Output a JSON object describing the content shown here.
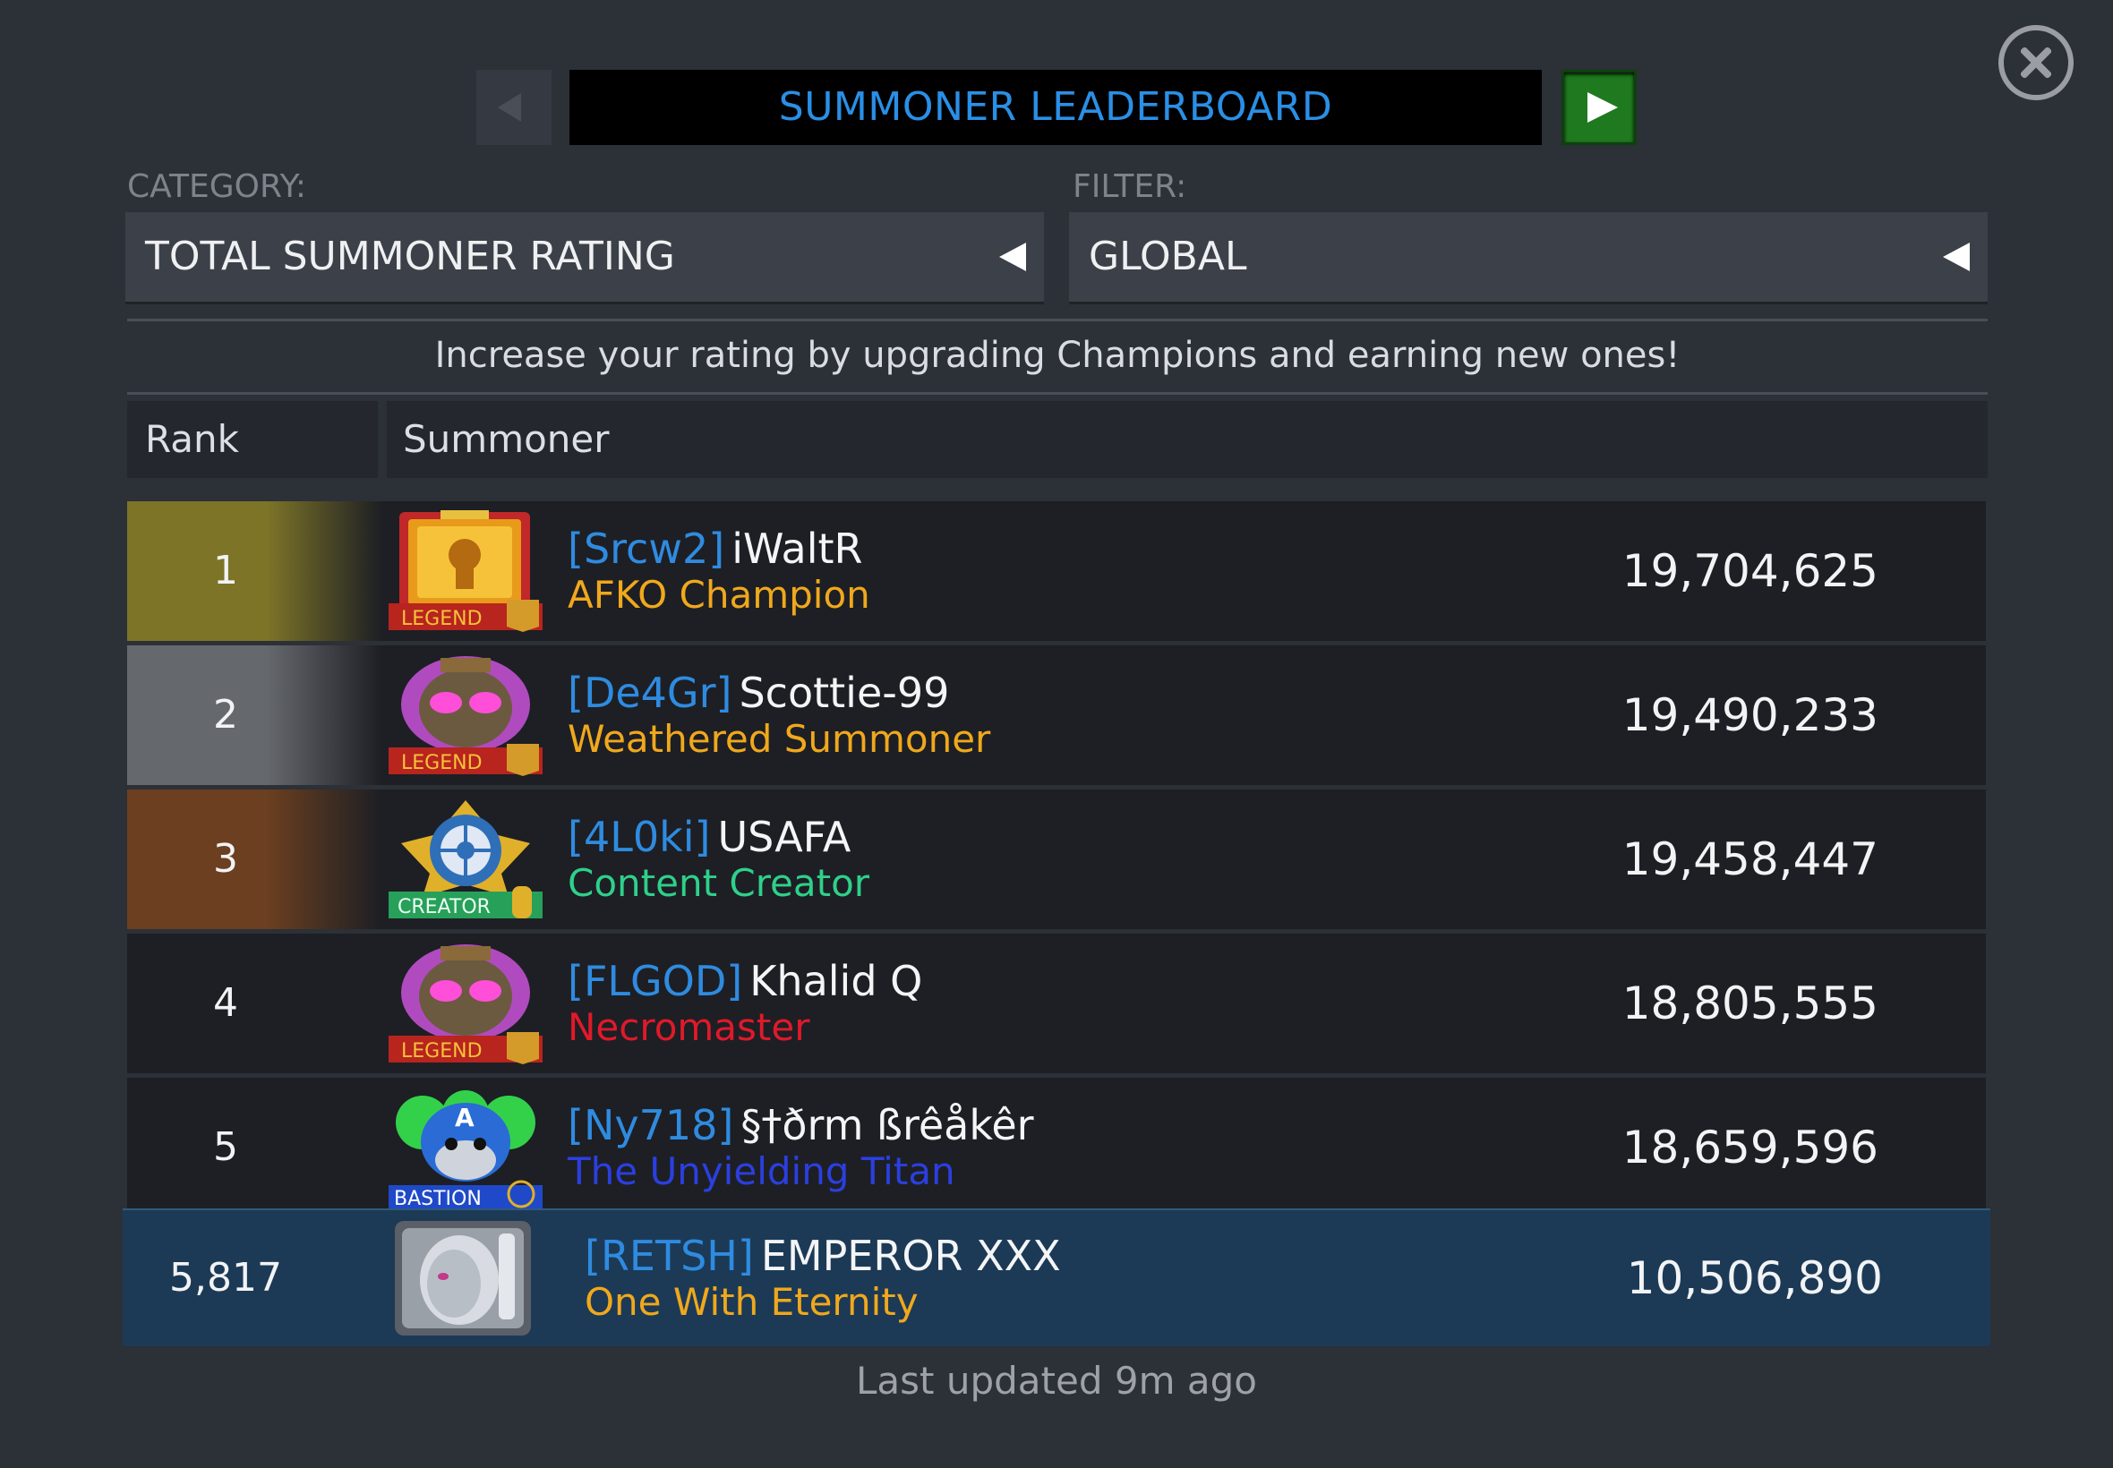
{
  "header": {
    "title": "SUMMONER LEADERBOARD"
  },
  "category": {
    "label": "CATEGORY:",
    "value": "TOTAL SUMMONER RATING"
  },
  "filter": {
    "label": "FILTER:",
    "value": "GLOBAL"
  },
  "hint": "Increase your rating by upgrading Champions and earning new ones!",
  "columns": {
    "rank": "Rank",
    "summoner": "Summoner"
  },
  "rows": [
    {
      "rank": "1",
      "tag": "[Srcw2]",
      "name": "iWaltR",
      "title": "AFKO Champion",
      "title_color": "#f0a81c",
      "score": "19,704,625",
      "badge": "LEGEND",
      "avatar": "gold-keyhole-avatar-icon"
    },
    {
      "rank": "2",
      "tag": "[De4Gr]",
      "name": "Scottie-99",
      "title": "Weathered Summoner",
      "title_color": "#f0a81c",
      "score": "19,490,233",
      "badge": "LEGEND",
      "avatar": "star-lord-helmet-avatar-icon"
    },
    {
      "rank": "3",
      "tag": "[4L0ki]",
      "name": "USAFA",
      "title": "Content Creator",
      "title_color": "#2fd08a",
      "score": "19,458,447",
      "badge": "CREATOR",
      "avatar": "compass-emblem-avatar-icon"
    },
    {
      "rank": "4",
      "tag": "[FLGOD]",
      "name": "Khalid Q",
      "title": "Necromaster",
      "title_color": "#e0192a",
      "score": "18,805,555",
      "badge": "LEGEND",
      "avatar": "star-lord-helmet-avatar-icon"
    },
    {
      "rank": "5",
      "tag": "[Ny718]",
      "name": "§†ðrm ßrêåkêr",
      "title": "The Unyielding Titan",
      "title_color": "#2b3fe0",
      "score": "18,659,596",
      "badge": "BASTION",
      "avatar": "captain-america-zombie-avatar-icon"
    }
  ],
  "me": {
    "rank": "5,817",
    "tag": "[RETSH]",
    "name": "EMPEROR XXX",
    "title": "One With Eternity",
    "title_color": "#f0a81c",
    "score": "10,506,890",
    "avatar": "silver-head-avatar-icon"
  },
  "footer": "Last updated 9m ago",
  "colors": {
    "accent": "#2a8fe6",
    "next_button": "#1f7a1f",
    "gold_rank": "#7d7428",
    "silver_rank": "#65686d",
    "bronze_rank": "#6b3f20",
    "self_row": "#1c3a56"
  }
}
